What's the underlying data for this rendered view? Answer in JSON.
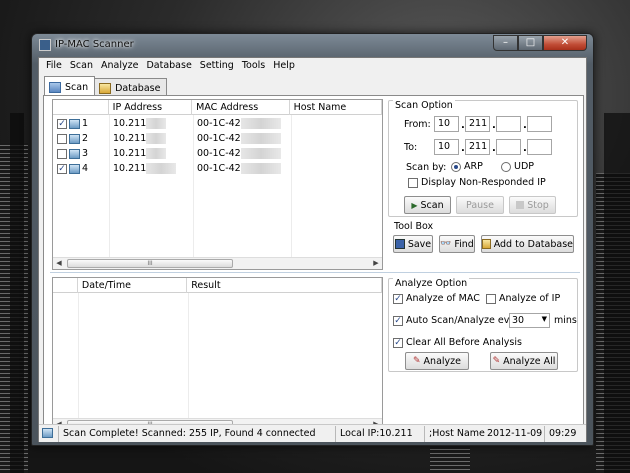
{
  "window": {
    "title": "IP-MAC Scanner",
    "min": "–",
    "max": "□",
    "close": "✕"
  },
  "menu": [
    "File",
    "Scan",
    "Analyze",
    "Database",
    "Setting",
    "Tools",
    "Help"
  ],
  "tabs": [
    {
      "label": "Scan",
      "active": true
    },
    {
      "label": "Database",
      "active": false
    }
  ],
  "scan_table": {
    "columns": [
      "",
      "IP Address",
      "MAC Address",
      "Host Name"
    ],
    "rows": [
      {
        "checked": true,
        "index": "1",
        "ip": "10.211",
        "mac": "00-1C-42"
      },
      {
        "checked": false,
        "index": "2",
        "ip": "10.211",
        "mac": "00-1C-42"
      },
      {
        "checked": false,
        "index": "3",
        "ip": "10.211",
        "mac": "00-1C-42"
      },
      {
        "checked": true,
        "index": "4",
        "ip": "10.211",
        "mac": "00-1C-42"
      }
    ]
  },
  "result_table": {
    "columns": [
      "",
      "Date/Time",
      "Result"
    ]
  },
  "scroll_thumb": "III",
  "scan_option": {
    "title": "Scan Option",
    "from_label": "From:",
    "from": [
      "10",
      "211",
      "",
      ""
    ],
    "to_label": "To:",
    "to": [
      "10",
      "211",
      "",
      ""
    ],
    "scan_by_label": "Scan by:",
    "arp": "ARP",
    "udp": "UDP",
    "arp_selected": true,
    "display_non_responded": "Display Non-Responded IP",
    "scan_btn": "Scan",
    "pause_btn": "Pause",
    "stop_btn": "Stop"
  },
  "toolbox": {
    "title": "Tool Box",
    "save": "Save",
    "find": "Find",
    "add_db": "Add to Database"
  },
  "analyze_option": {
    "title": "Analyze Option",
    "analyze_mac": "Analyze of MAC",
    "analyze_mac_checked": true,
    "analyze_ip": "Analyze of IP",
    "analyze_ip_checked": false,
    "auto_scan": "Auto Scan/Analyze every",
    "auto_scan_checked": true,
    "interval": "30",
    "mins": "mins",
    "clear_all": "Clear All Before Analysis",
    "clear_all_checked": true,
    "analyze_btn": "Analyze",
    "analyze_all_btn": "Analyze All"
  },
  "status": {
    "message": "Scan Complete! Scanned: 255 IP, Found 4 connected",
    "local_ip": "Local IP:10.211",
    "host_name": ";Host Name",
    "date": "2012-11-09",
    "time": "09:29"
  },
  "check_mark": "✓"
}
